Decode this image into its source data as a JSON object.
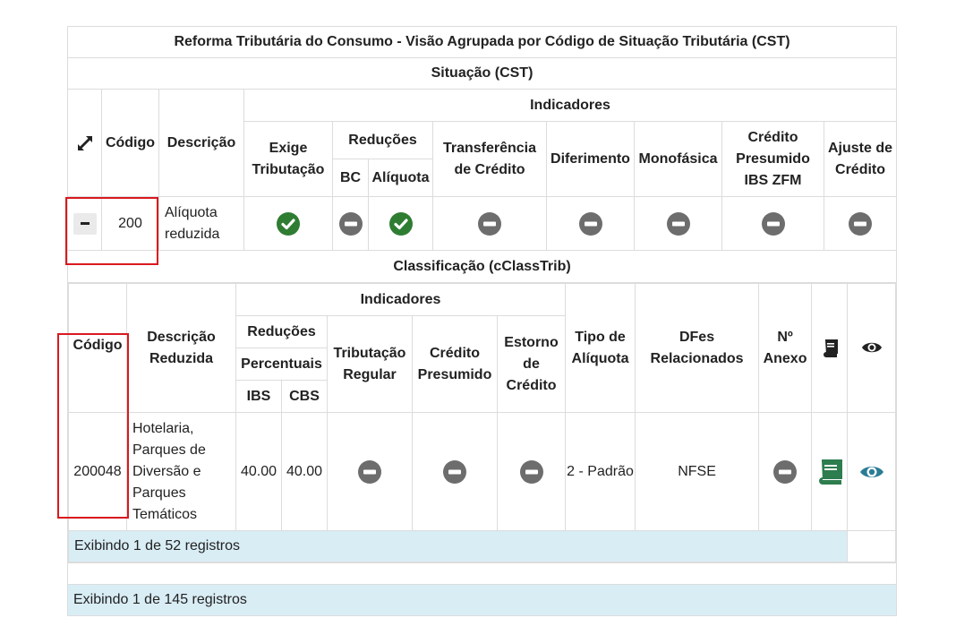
{
  "title": "Reforma Tributária do Consumo - Visão Agrupada por Código de Situação Tributária (CST)",
  "cst_section": "Situação (CST)",
  "cst_headers": {
    "codigo": "Código",
    "descricao": "Descrição",
    "indicadores": "Indicadores",
    "exige_tributacao": "Exige Tributação",
    "reducoes": "Reduções",
    "bc": "BC",
    "aliquota": "Alíquota",
    "transferencia": "Transferência de Crédito",
    "diferimento": "Diferimento",
    "monofasica": "Monofásica",
    "credito_presumido_zfm": "Crédito Presumido IBS ZFM",
    "ajuste_credito": "Ajuste de Crédito"
  },
  "cst_row": {
    "codigo": "200",
    "descricao": "Alíquota reduzida",
    "exige_tributacao": "check-icon",
    "bc": "minus-circle-icon",
    "aliquota": "check-icon",
    "transferencia": "minus-circle-icon",
    "diferimento": "minus-circle-icon",
    "monofasica": "minus-circle-icon",
    "credito_presumido_zfm": "minus-circle-icon",
    "ajuste_credito": "minus-circle-icon"
  },
  "class_section": "Classificação (cClassTrib)",
  "class_headers": {
    "codigo": "Código",
    "descricao_reduzida": "Descrição Reduzida",
    "indicadores": "Indicadores",
    "reducoes": "Reduções",
    "percentuais": "Percentuais",
    "ibs": "IBS",
    "cbs": "CBS",
    "tributacao_regular": "Tributação Regular",
    "credito_presumido": "Crédito Presumido",
    "estorno_credito": "Estorno de Crédito",
    "tipo_aliquota": "Tipo de Alíquota",
    "dfes": "DFes Relacionados",
    "n_anexo": "Nº Anexo"
  },
  "class_row": {
    "codigo": "200048",
    "descricao": "Hotelaria, Parques de Diversão e Parques Temáticos",
    "ibs": "40.00",
    "cbs": "40.00",
    "tipo_aliquota": "2 - Padrão",
    "dfes": "NFSE"
  },
  "inner_footer": "Exibindo 1 de 52 registros",
  "outer_footer": "Exibindo 1 de 145 registros",
  "colors": {
    "check": "#2e7d32",
    "minus": "#6d6d6d",
    "book": "#2e7d4f",
    "eye": "#2a7c94",
    "footer_bg": "#d9edf5",
    "highlight": "#d9191e"
  }
}
